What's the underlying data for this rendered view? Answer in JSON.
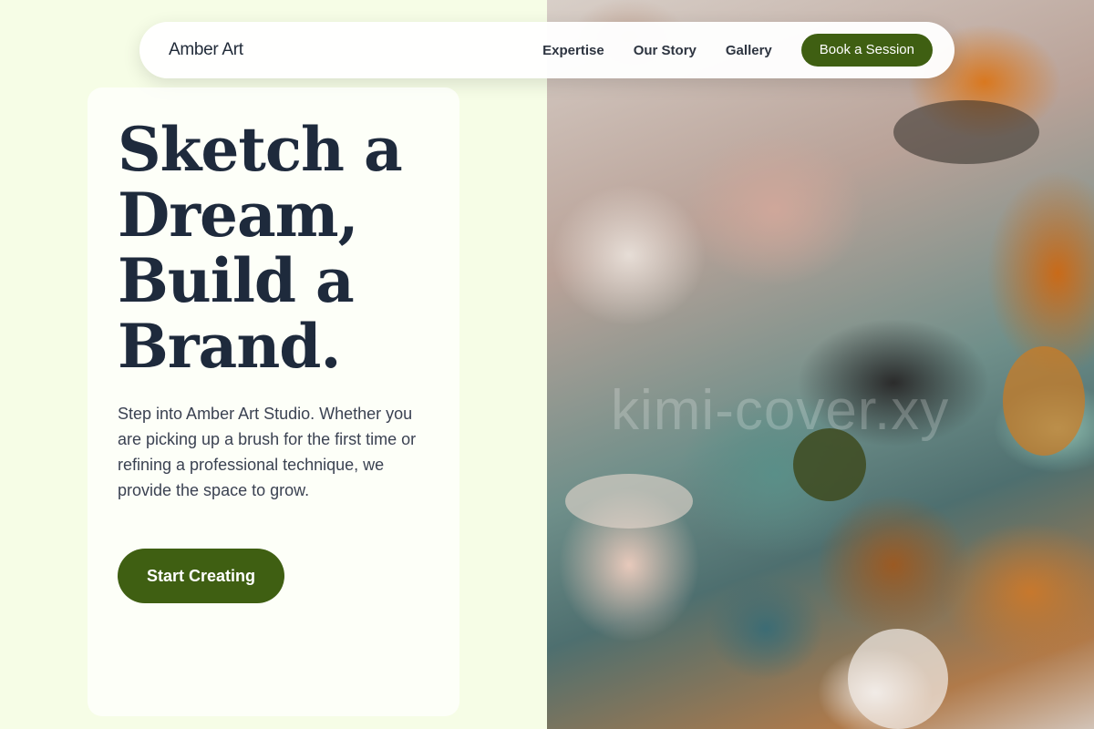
{
  "nav": {
    "brand": "Amber Art",
    "links": [
      "Expertise",
      "Our Story",
      "Gallery"
    ],
    "cta": "Book a Session"
  },
  "hero": {
    "title_lines": [
      "Sketch a",
      "Dream,",
      "Build a",
      "Brand."
    ],
    "description": "Step into Amber Art Studio. Whether you are picking up a brush for the first time or refining a professional technique, we provide the space to grow.",
    "cta": "Start Creating"
  },
  "art": {
    "watermark": "kimi-cover.xy"
  },
  "colors": {
    "accent": "#3f5f12",
    "background": "#f6fde6",
    "heading": "#1e2a3c"
  }
}
